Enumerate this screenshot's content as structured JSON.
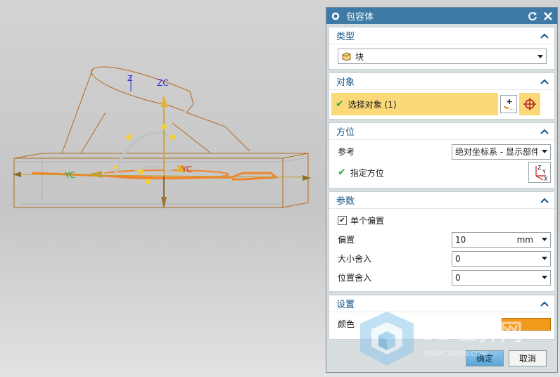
{
  "viewport": {
    "axis_labels": {
      "zc": "ZC",
      "z": "Z",
      "yc_left": "YC",
      "yc_right": "YC"
    }
  },
  "dialog": {
    "title": "包容体",
    "type_group": {
      "title": "类型",
      "selected": "块"
    },
    "object_group": {
      "title": "对象",
      "select_label": "选择对象 (1)"
    },
    "orientation_group": {
      "title": "方位",
      "reference_label": "参考",
      "reference_value": "绝对坐标系 - 显示部件",
      "specify_label": "指定方位",
      "csys_icon_labels": {
        "z": "Z",
        "y": "Y",
        "x": "X"
      }
    },
    "parameters_group": {
      "title": "参数",
      "single_offset_label": "单个偏置",
      "single_offset_checked": true,
      "offset_label": "偏置",
      "offset_value": "10",
      "offset_unit": "mm",
      "size_round_label": "大小舍入",
      "size_round_value": "0",
      "position_round_label": "位置舍入",
      "position_round_value": "0"
    },
    "settings_group": {
      "title": "设置",
      "color_label": "颜色",
      "color_value": "#f29a1c"
    },
    "ok_label": "确定",
    "cancel_label": "取消"
  },
  "watermark": {
    "text": "3D世界网",
    "url": "WWW.3DSJW.COM"
  }
}
